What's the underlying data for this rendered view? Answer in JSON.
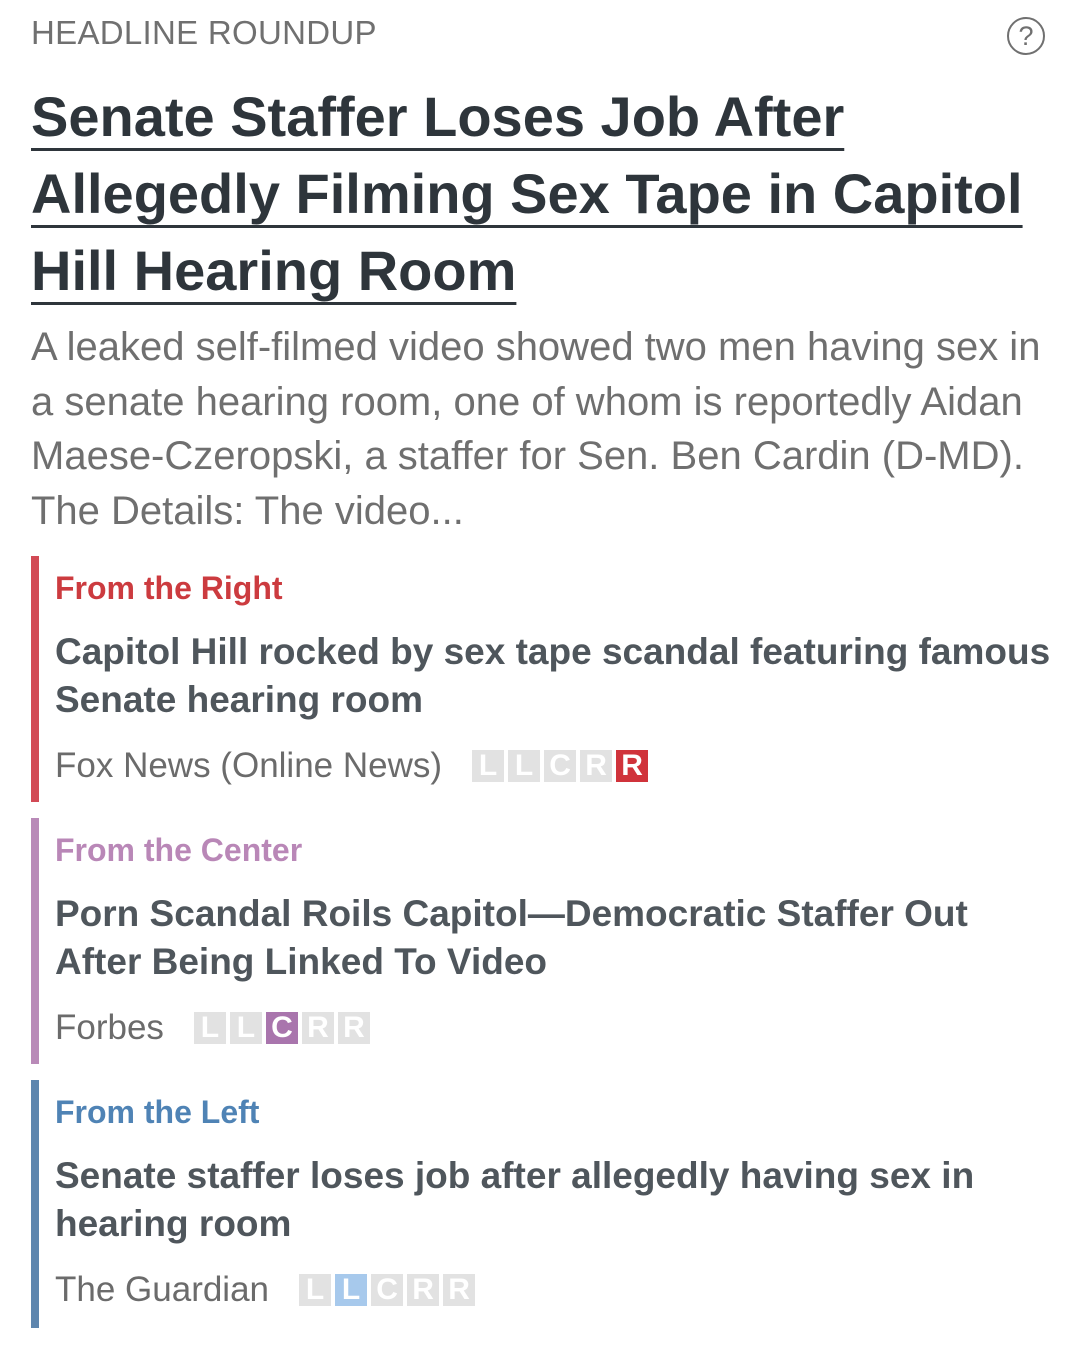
{
  "section_label": "HEADLINE ROUNDUP",
  "help_icon": "?",
  "headline_lines": [
    "Senate Staffer Loses Job After",
    "Allegedly Filming Sex Tape in Capitol",
    "Hill Hearing Room"
  ],
  "summary": "A leaked self-filmed video showed two men having sex in a senate hearing room, one of whom is reportedly Aidan Maese-Czeropski, a staffer for Sen. Ben Cardin (D-MD). The Details: The video...",
  "stories": [
    {
      "side": "From the Right",
      "title": "Capitol Hill rocked by sex tape scandal featuring famous Senate hearing room",
      "source": "Fox News (Online News)",
      "bias_labels": [
        "L",
        "L",
        "C",
        "R",
        "R"
      ],
      "active_index": 4
    },
    {
      "side": "From the Center",
      "title": "Porn Scandal Roils Capitol—Democratic Staffer Out After Being Linked To Video",
      "source": "Forbes",
      "bias_labels": [
        "L",
        "L",
        "C",
        "R",
        "R"
      ],
      "active_index": 2
    },
    {
      "side": "From the Left",
      "title": "Senate staffer loses job after allegedly having sex in hearing room",
      "source": "The Guardian",
      "bias_labels": [
        "L",
        "L",
        "C",
        "R",
        "R"
      ],
      "active_index": 1
    }
  ],
  "colors": {
    "right": "#d0333b",
    "center": "#a975ad",
    "left": "#a7c9ec"
  }
}
